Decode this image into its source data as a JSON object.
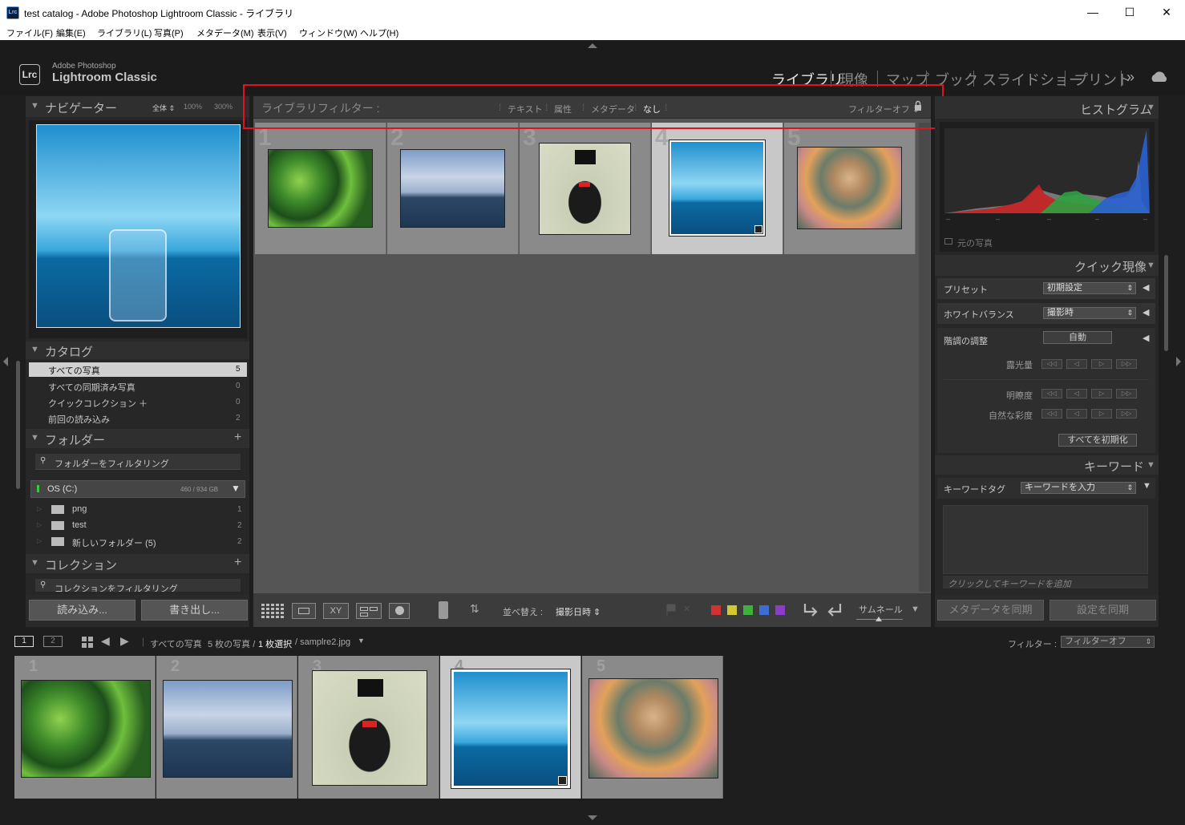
{
  "window": {
    "title": "test catalog - Adobe Photoshop Lightroom Classic - ライブラリ",
    "app_icon": "Lrc"
  },
  "menu": [
    "ファイル(F)",
    "編集(E)",
    "ライブラリ(L)",
    "写真(P)",
    "メタデータ(M)",
    "表示(V)",
    "ウィンドウ(W)",
    "ヘルプ(H)"
  ],
  "logo": {
    "mark": "Lrc",
    "small": "Adobe Photoshop",
    "big": "Lightroom Classic"
  },
  "modules": [
    "ライブラリ",
    "現像",
    "マップ",
    "ブック",
    "スライドショー",
    "プリント"
  ],
  "modules_more": "»",
  "navigator": {
    "title": "ナビゲーター",
    "zoom_fit": "全体 ⇕",
    "zoom_100": "100%",
    "zoom_300": "300%"
  },
  "catalog": {
    "title": "カタログ",
    "items": [
      {
        "label": "すべての写真",
        "count": "5"
      },
      {
        "label": "すべての同期済み写真",
        "count": "0"
      },
      {
        "label": "クイックコレクション ＋",
        "count": "0"
      },
      {
        "label": "前回の読み込み",
        "count": "2"
      }
    ]
  },
  "folders": {
    "title": "フォルダー",
    "add": "+",
    "filter_placeholder": "フォルダーをフィルタリング",
    "volume": "OS (C:)",
    "volume_size": "460 / 934 GB",
    "items": [
      {
        "label": "png",
        "count": "1"
      },
      {
        "label": "test",
        "count": "2"
      },
      {
        "label": "新しいフォルダー (5)",
        "count": "2"
      }
    ]
  },
  "collections": {
    "title": "コレクション",
    "add": "+",
    "filter_placeholder": "コレクションをフィルタリング"
  },
  "left_buttons": {
    "import": "読み込み...",
    "export": "書き出し..."
  },
  "filter_bar": {
    "title": "ライブラリフィルター :",
    "tabs": [
      "テキスト",
      "属性",
      "メタデータ",
      "なし"
    ],
    "preset": "フィルターオフ ⇕"
  },
  "grid": {
    "cells": [
      {
        "num": "1"
      },
      {
        "num": "2"
      },
      {
        "num": "3"
      },
      {
        "num": "4"
      },
      {
        "num": "5"
      }
    ]
  },
  "histogram": {
    "title": "ヒストグラム",
    "original_photo": "元の写真",
    "ticks": [
      "–",
      "–",
      "–",
      "–",
      "–"
    ]
  },
  "quick_develop": {
    "title": "クイック現像",
    "preset_label": "プリセット",
    "preset_value": "初期設定",
    "wb_label": "ホワイトバランス",
    "wb_value": "撮影時",
    "tone_label": "階調の調整",
    "auto": "自動",
    "exposure": "露光量",
    "clarity": "明瞭度",
    "vibrance": "自然な彩度",
    "reset": "すべてを初期化",
    "step_labels": [
      "◁◁",
      "◁",
      "▷",
      "▷▷"
    ]
  },
  "keywords": {
    "title": "キーワード",
    "tag_label": "キーワードタグ",
    "tag_value": "キーワードを入力",
    "add_hint": "クリックしてキーワードを追加"
  },
  "right_buttons": {
    "sync_meta": "メタデータを同期",
    "sync_settings": "設定を同期"
  },
  "toolbar": {
    "sort_label": "並べ替え :",
    "sort_value": "撮影日時 ⇕",
    "thumb_label": "サムネール",
    "xy": "XY",
    "colors": [
      "#d23232",
      "#d2c832",
      "#3cb43c",
      "#3c6ed2",
      "#8c3cc8"
    ]
  },
  "filmnav": {
    "screen1": "1",
    "screen2": "2",
    "path_prefix": "すべての写真",
    "path_count": "5 枚の写真 /",
    "path_selected": "1 枚選択",
    "path_file": "/ samplre2.jpg",
    "filter_label": "フィルター :",
    "filter_value": "フィルターオフ"
  },
  "filmstrip": {
    "cells": [
      {
        "num": "1"
      },
      {
        "num": "2"
      },
      {
        "num": "3"
      },
      {
        "num": "4"
      },
      {
        "num": "5"
      }
    ]
  },
  "colors": {
    "selection_box": "#e0141e",
    "panel": "#272727",
    "grid_bg": "#555555"
  }
}
